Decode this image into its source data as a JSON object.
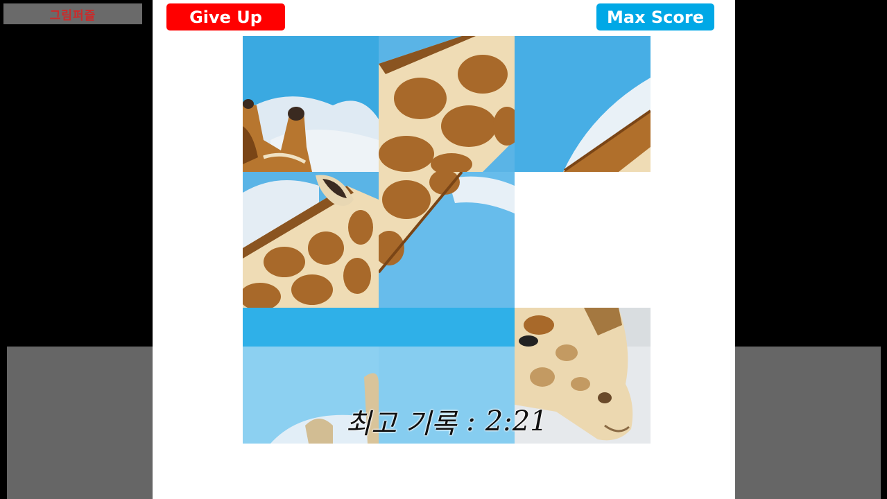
{
  "app": {
    "title": "그림퍼즐"
  },
  "toolbar": {
    "give_up_label": "Give Up",
    "max_score_label": "Max Score"
  },
  "best_record": {
    "label": "최고 기록",
    "separator": ":",
    "time": "2:21"
  },
  "colors": {
    "give_up": "#ff0000",
    "max_score": "#00a8e6",
    "sky": "#4eb3e6",
    "giraffe_patch": "#a8692a",
    "giraffe_line": "#f1e2c2"
  },
  "puzzle": {
    "grid_size": 3,
    "empty_slot": "row-2-col-3",
    "tiles": [
      {
        "slot": "row-1-col-1",
        "icon": "giraffe-ossicones-tile"
      },
      {
        "slot": "row-1-col-2",
        "icon": "giraffe-neck-pattern-tile"
      },
      {
        "slot": "row-1-col-3",
        "icon": "giraffe-neck-edge-sky-tile"
      },
      {
        "slot": "row-2-col-1",
        "icon": "giraffe-ear-neck-tile"
      },
      {
        "slot": "row-2-col-2",
        "icon": "giraffe-neck-sky-tile"
      },
      {
        "slot": "row-3-col-1",
        "icon": "sky-ear-tile"
      },
      {
        "slot": "row-3-col-2",
        "icon": "sky-tile"
      },
      {
        "slot": "row-3-col-3",
        "icon": "giraffe-face-tile"
      }
    ]
  }
}
